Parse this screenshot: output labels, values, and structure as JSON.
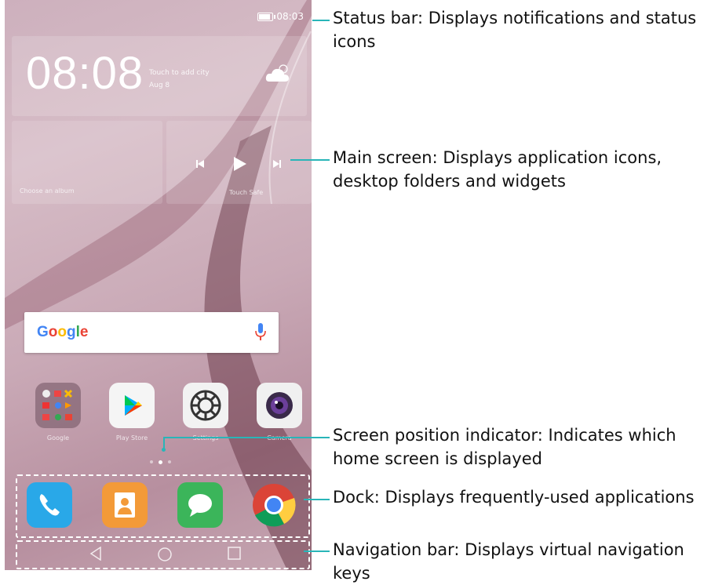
{
  "status_bar": {
    "time": "08:03"
  },
  "clock_widget": {
    "time": "08:08",
    "city_prompt": "Touch to add city",
    "date": "Aug 8"
  },
  "album_widget": {
    "label": "Choose an album"
  },
  "music_widget": {
    "label": "Touch Safe"
  },
  "search": {
    "brand": "Google"
  },
  "apps": [
    {
      "label": "Google",
      "icon": "google-folder-icon"
    },
    {
      "label": "Play Store",
      "icon": "play-store-icon"
    },
    {
      "label": "Settings",
      "icon": "settings-gear-icon"
    },
    {
      "label": "Camera",
      "icon": "camera-icon"
    }
  ],
  "dock": [
    {
      "icon": "phone-icon"
    },
    {
      "icon": "contacts-icon"
    },
    {
      "icon": "messaging-icon"
    },
    {
      "icon": "chrome-icon"
    }
  ],
  "navigation_keys": [
    "back-icon",
    "home-icon",
    "recents-icon"
  ],
  "callouts": {
    "status_bar": "Status bar: Displays notifications and status icons",
    "main_screen": "Main screen: Displays application icons, desktop folders and widgets",
    "position_indicator": "Screen position indicator: Indicates which home screen is displayed",
    "dock": "Dock: Displays frequently-used applications",
    "navigation_bar": "Navigation bar: Displays virtual navigation keys"
  },
  "colors": {
    "accent": "#29b5b8",
    "dock_border": "#ffffff"
  }
}
